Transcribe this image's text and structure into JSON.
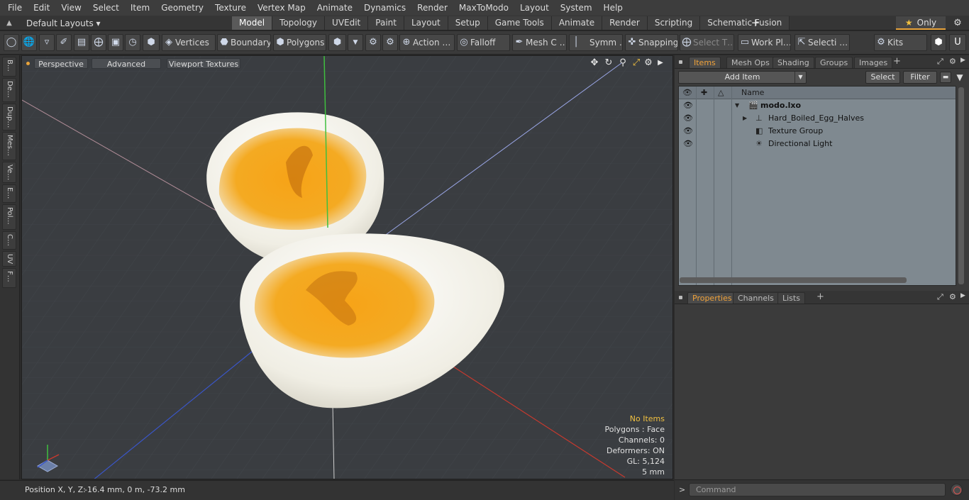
{
  "menu": [
    "File",
    "Edit",
    "View",
    "Select",
    "Item",
    "Geometry",
    "Texture",
    "Vertex Map",
    "Animate",
    "Dynamics",
    "Render",
    "MaxToModo",
    "Layout",
    "System",
    "Help"
  ],
  "layouts": {
    "label": "Default Layouts ▾"
  },
  "main_tabs": [
    "Model",
    "Topology",
    "UVEdit",
    "Paint",
    "Layout",
    "Setup",
    "Game Tools",
    "Animate",
    "Render",
    "Scripting",
    "Schematic Fusion"
  ],
  "only_label": "Only",
  "toolbar": {
    "vertices": "Vertices",
    "boundary": "Boundary",
    "polygons": "Polygons",
    "action": "Action …",
    "falloff": "Falloff",
    "mesh": "Mesh C …",
    "symm": "Symm …",
    "snapping": "Snapping",
    "select_t": "Select T…",
    "work_pl": "Work Pl…",
    "selecti": "Selecti …",
    "kits": "Kits"
  },
  "left_tabs": [
    "B…",
    "De…",
    "Dup…",
    "Mes…",
    "Ve…",
    "E…",
    "Pol…",
    "C…",
    "UV",
    "F…"
  ],
  "viewport": {
    "perspective": "Perspective",
    "advanced": "Advanced",
    "viewport_textures": "Viewport Textures",
    "stats": {
      "no_items": "No Items",
      "polygons": "Polygons : Face",
      "channels": "Channels: 0",
      "deformers": "Deformers: ON",
      "gl": "GL: 5,124",
      "scale": "5 mm"
    },
    "colors": {
      "bg": "#3a3d41",
      "yolk": "#f3a21a",
      "white": "#f1efe6",
      "x_axis": "#c8392e",
      "y_axis": "#3fbf3f",
      "z_axis": "#3a56c8"
    }
  },
  "status": {
    "position_label": "Position X, Y, Z:",
    "position_value": "-16.4 mm, 0 m, -73.2 mm"
  },
  "items_panel": {
    "tabs": [
      "Items",
      "Mesh Ops",
      "Shading",
      "Groups",
      "Images"
    ],
    "add_item": "Add Item",
    "select": "Select",
    "filter": "Filter",
    "column_name": "Name",
    "rows": [
      {
        "name": "modo.lxo",
        "icon": "scene-icon"
      },
      {
        "name": "Hard_Boiled_Egg_Halves",
        "icon": "mesh-locator-icon"
      },
      {
        "name": "Texture Group",
        "icon": "texture-group-icon"
      },
      {
        "name": "Directional Light",
        "icon": "light-icon"
      }
    ]
  },
  "props_panel": {
    "tabs": [
      "Properties",
      "Channels",
      "Lists"
    ]
  },
  "command": {
    "placeholder": "Command",
    "prompt": ">"
  }
}
